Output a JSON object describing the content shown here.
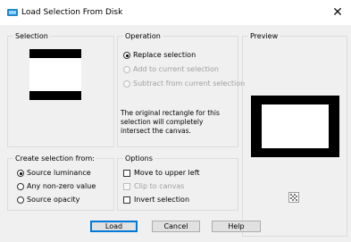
{
  "window": {
    "title": "Load Selection From Disk",
    "close_glyph": "✕"
  },
  "selection_panel": {
    "title": "Selection"
  },
  "operation_panel": {
    "title": "Operation",
    "options": [
      {
        "label": "Replace selection",
        "checked": true,
        "enabled": true
      },
      {
        "label": "Add to current selection",
        "checked": false,
        "enabled": false
      },
      {
        "label": "Subtract from current selection",
        "checked": false,
        "enabled": false
      }
    ],
    "message": "The original rectangle for this selection will completely intersect the canvas."
  },
  "preview_panel": {
    "title": "Preview"
  },
  "create_from_panel": {
    "title": "Create selection from:",
    "options": [
      {
        "label": "Source luminance",
        "checked": true
      },
      {
        "label": "Any non-zero value",
        "checked": false
      },
      {
        "label": "Source opacity",
        "checked": false
      }
    ]
  },
  "options_panel": {
    "title": "Options",
    "items": [
      {
        "label": "Move to upper left",
        "checked": false,
        "enabled": true
      },
      {
        "label": "Clip to canvas",
        "checked": false,
        "enabled": false
      },
      {
        "label": "Invert selection",
        "checked": false,
        "enabled": true
      }
    ]
  },
  "buttons": {
    "load": "Load",
    "cancel": "Cancel",
    "help": "Help"
  },
  "colors": {
    "accent": "#0078d7",
    "panel_border": "#dcdcdc",
    "dialog_bg": "#f0f0f0"
  }
}
